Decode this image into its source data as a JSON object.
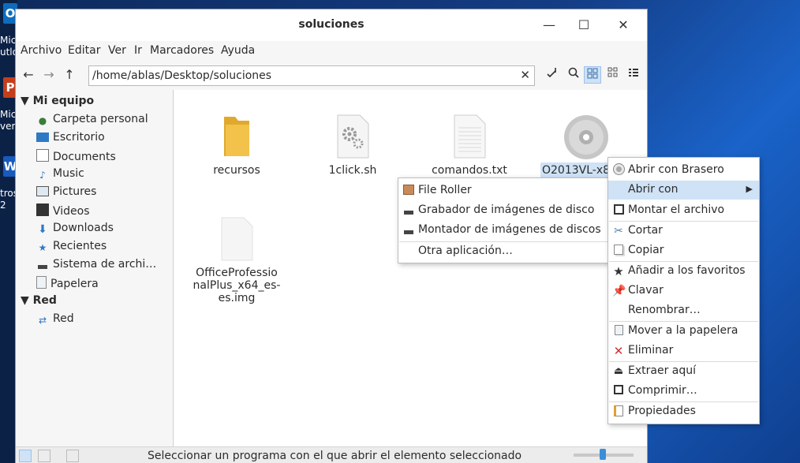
{
  "desktop": {
    "items": [
      {
        "badge": "O",
        "color": "#0f6cbd",
        "lines": [
          "Mic",
          "utlo"
        ]
      },
      {
        "badge": "P",
        "color": "#c43e1c",
        "lines": [
          "Mic",
          "ver"
        ]
      },
      {
        "badge": "W",
        "color": "#185abd",
        "lines": [
          "tros",
          "2"
        ]
      }
    ]
  },
  "window": {
    "title": "soluciones",
    "controls": {
      "minimize": "—",
      "maximize": "☐",
      "close": "✕"
    }
  },
  "menubar": [
    "Archivo",
    "Editar",
    "Ver",
    "Ir",
    "Marcadores",
    "Ayuda"
  ],
  "toolbar": {
    "back": "←",
    "forward": "→",
    "up": "↑",
    "path": "/home/ablas/Desktop/soluciones",
    "clear": "✕",
    "icons": [
      "terminal-icon",
      "search-icon",
      "icon-view-icon",
      "compact-view-icon",
      "list-view-icon"
    ]
  },
  "sidebar": {
    "sections": [
      {
        "title": "Mi equipo",
        "items": [
          {
            "label": "Carpeta personal",
            "icon": "user-home-icon"
          },
          {
            "label": "Escritorio",
            "icon": "desktop-icon"
          },
          {
            "label": "Documents",
            "icon": "documents-icon"
          },
          {
            "label": "Music",
            "icon": "music-icon"
          },
          {
            "label": "Pictures",
            "icon": "pictures-icon"
          },
          {
            "label": "Videos",
            "icon": "videos-icon"
          },
          {
            "label": "Downloads",
            "icon": "downloads-icon"
          },
          {
            "label": "Recientes",
            "icon": "recent-icon"
          },
          {
            "label": "Sistema de archi…",
            "icon": "filesystem-icon"
          },
          {
            "label": "Papelera",
            "icon": "trash-icon"
          }
        ]
      },
      {
        "title": "Red",
        "items": [
          {
            "label": "Red",
            "icon": "network-icon"
          }
        ]
      }
    ]
  },
  "files": [
    {
      "name": "recursos",
      "icon": "folder-icon"
    },
    {
      "name": "1click.sh",
      "icon": "script-icon"
    },
    {
      "name": "comandos.txt",
      "icon": "text-file-icon"
    },
    {
      "name": "O2013VL-x86",
      "icon": "disc-image-icon",
      "selected": true
    },
    {
      "name": "OfficeProfessionalPlus_x64_es-es.img",
      "lines": [
        "OfficeProfessio",
        "nalPlus_x64_es-",
        "es.img"
      ],
      "icon": "blank-file-icon"
    }
  ],
  "context_menu": {
    "items": [
      {
        "label": "Abrir con Brasero",
        "icon": "brasero-icon"
      },
      {
        "label": "Abrir con",
        "icon": "",
        "submenu": true,
        "hover": true
      },
      {
        "label": "Montar el archivo",
        "icon": "mount-icon"
      },
      {
        "label": "Cortar",
        "icon": "cut-icon"
      },
      {
        "label": "Copiar",
        "icon": "copy-icon"
      },
      {
        "label": "Añadir a los favoritos",
        "icon": "star-icon"
      },
      {
        "label": "Clavar",
        "icon": "pin-icon"
      },
      {
        "label": "Renombrar…",
        "icon": ""
      },
      {
        "label": "Mover a la papelera",
        "icon": "trash-icon"
      },
      {
        "label": "Eliminar",
        "icon": "delete-icon"
      },
      {
        "label": "Extraer aquí",
        "icon": "extract-icon"
      },
      {
        "label": "Comprimir…",
        "icon": "compress-icon"
      },
      {
        "label": "Propiedades",
        "icon": "properties-icon"
      }
    ],
    "submenu_arrow": "▶"
  },
  "submenu": {
    "items": [
      {
        "label": "File Roller",
        "icon": "archive-icon"
      },
      {
        "label": "Grabador de imágenes de disco",
        "icon": "drive-icon"
      },
      {
        "label": "Montador de imágenes de discos",
        "icon": "drive-icon"
      },
      {
        "label": "Otra aplicación…",
        "icon": ""
      }
    ]
  },
  "statusbar": {
    "text": "Seleccionar un programa con el que abrir el elemento seleccionado"
  },
  "colors": {
    "selection": "#cfe2f6",
    "folder": "#f0c145",
    "accent": "#3b8ed8"
  }
}
